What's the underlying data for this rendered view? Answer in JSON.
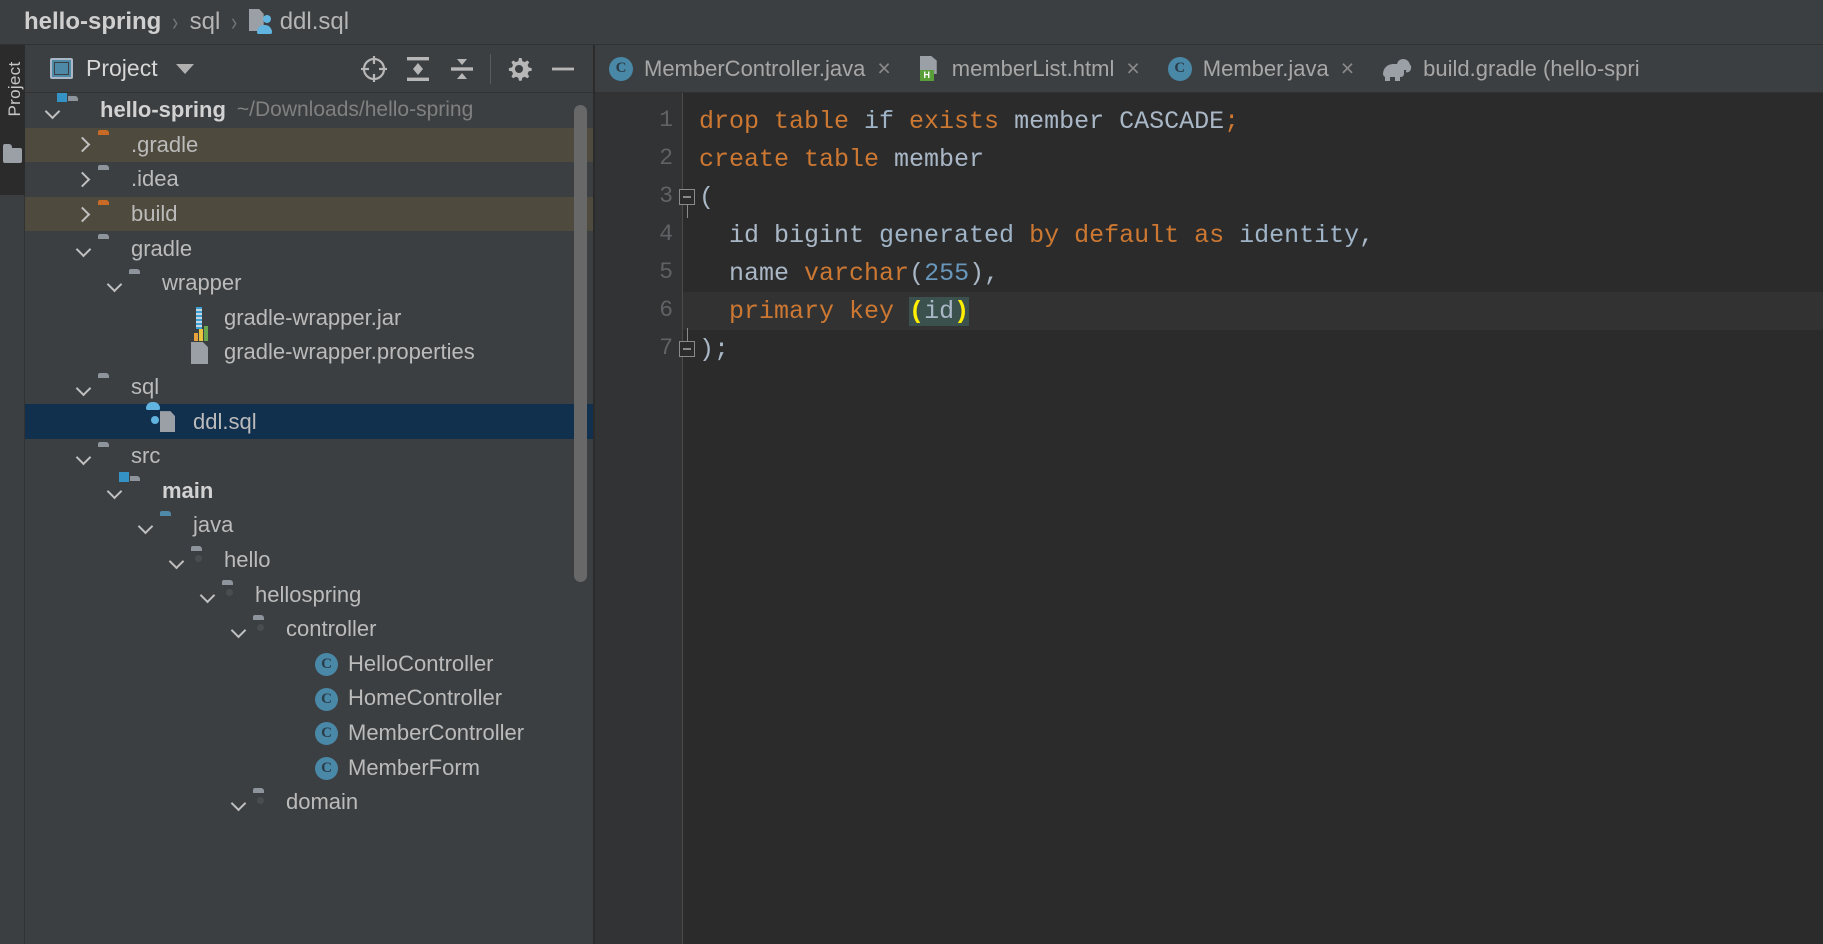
{
  "breadcrumb": {
    "project": "hello-spring",
    "folder": "sql",
    "file": "ddl.sql",
    "sep": "›",
    "file_icon": "sql-file-icon"
  },
  "tool_strip": {
    "label": "Project",
    "icon": "project-folder-icon"
  },
  "project_panel": {
    "title": "Project",
    "caret_icon": "chevron-down-icon",
    "panel_icon": "project-view-icon",
    "toolbar": [
      {
        "name": "select-opened-file-button",
        "icon": "crosshair-target-icon"
      },
      {
        "name": "expand-all-button",
        "icon": "expand-all-icon"
      },
      {
        "name": "collapse-all-button",
        "icon": "collapse-all-icon"
      },
      {
        "name": "settings-button",
        "icon": "gear-icon"
      },
      {
        "name": "hide-button",
        "icon": "minus-icon"
      }
    ],
    "tree": [
      {
        "label": "hello-spring",
        "path": "~/Downloads/hello-spring",
        "indent": 0,
        "arrow": "down",
        "icon": "module-folder-icon",
        "state": "normal",
        "bold": true
      },
      {
        "label": ".gradle",
        "path": "",
        "indent": 1,
        "arrow": "right",
        "icon": "excluded-folder-icon",
        "state": "excluded",
        "bold": false
      },
      {
        "label": ".idea",
        "path": "",
        "indent": 1,
        "arrow": "right",
        "icon": "folder-icon",
        "state": "normal",
        "bold": false
      },
      {
        "label": "build",
        "path": "",
        "indent": 1,
        "arrow": "right",
        "icon": "excluded-folder-icon",
        "state": "excluded",
        "bold": false
      },
      {
        "label": "gradle",
        "path": "",
        "indent": 1,
        "arrow": "down",
        "icon": "folder-icon",
        "state": "normal",
        "bold": false
      },
      {
        "label": "wrapper",
        "path": "",
        "indent": 2,
        "arrow": "down",
        "icon": "folder-icon",
        "state": "normal",
        "bold": false
      },
      {
        "label": "gradle-wrapper.jar",
        "path": "",
        "indent": 4,
        "arrow": "none",
        "icon": "jar-file-icon",
        "state": "normal",
        "bold": false
      },
      {
        "label": "gradle-wrapper.properties",
        "path": "",
        "indent": 4,
        "arrow": "none",
        "icon": "properties-file-icon",
        "state": "normal",
        "bold": false
      },
      {
        "label": "sql",
        "path": "",
        "indent": 1,
        "arrow": "down",
        "icon": "folder-icon",
        "state": "normal",
        "bold": false
      },
      {
        "label": "ddl.sql",
        "path": "",
        "indent": 3,
        "arrow": "none",
        "icon": "sql-file-icon",
        "state": "selected",
        "bold": false
      },
      {
        "label": "src",
        "path": "",
        "indent": 1,
        "arrow": "down",
        "icon": "folder-icon",
        "state": "normal",
        "bold": false
      },
      {
        "label": "main",
        "path": "",
        "indent": 2,
        "arrow": "down",
        "icon": "module-folder-icon",
        "state": "normal",
        "bold": true
      },
      {
        "label": "java",
        "path": "",
        "indent": 3,
        "arrow": "down",
        "icon": "source-folder-icon",
        "state": "normal",
        "bold": false
      },
      {
        "label": "hello",
        "path": "",
        "indent": 4,
        "arrow": "down",
        "icon": "package-icon",
        "state": "normal",
        "bold": false
      },
      {
        "label": "hellospring",
        "path": "",
        "indent": 5,
        "arrow": "down",
        "icon": "package-icon",
        "state": "normal",
        "bold": false
      },
      {
        "label": "controller",
        "path": "",
        "indent": 6,
        "arrow": "down",
        "icon": "package-icon",
        "state": "normal",
        "bold": false
      },
      {
        "label": "HelloController",
        "path": "",
        "indent": 8,
        "arrow": "none",
        "icon": "java-class-icon",
        "state": "normal",
        "bold": false
      },
      {
        "label": "HomeController",
        "path": "",
        "indent": 8,
        "arrow": "none",
        "icon": "java-class-icon",
        "state": "normal",
        "bold": false
      },
      {
        "label": "MemberController",
        "path": "",
        "indent": 8,
        "arrow": "none",
        "icon": "java-class-icon",
        "state": "normal",
        "bold": false
      },
      {
        "label": "MemberForm",
        "path": "",
        "indent": 8,
        "arrow": "none",
        "icon": "java-class-icon",
        "state": "normal",
        "bold": false
      },
      {
        "label": "domain",
        "path": "",
        "indent": 6,
        "arrow": "down",
        "icon": "package-icon",
        "state": "normal",
        "bold": false
      }
    ]
  },
  "editor": {
    "tabs": [
      {
        "label": "MemberController.java",
        "icon": "java-class-icon",
        "closable": true,
        "active": false
      },
      {
        "label": "memberList.html",
        "icon": "html-file-icon",
        "closable": true,
        "active": false
      },
      {
        "label": "Member.java",
        "icon": "java-class-icon",
        "closable": true,
        "active": false
      },
      {
        "label": "build.gradle (hello-spri",
        "icon": "gradle-file-icon",
        "closable": false,
        "active": false
      }
    ],
    "close_glyph": "×",
    "caret_line": 6,
    "lines": [
      {
        "num": 1,
        "fold": "",
        "tokens": [
          {
            "t": "drop table ",
            "c": "kw"
          },
          {
            "t": "if ",
            "c": "kw2"
          },
          {
            "t": "exists ",
            "c": "kw"
          },
          {
            "t": "member ",
            "c": "plain"
          },
          {
            "t": "CASCADE",
            "c": "plain"
          },
          {
            "t": ";",
            "c": "kw"
          }
        ]
      },
      {
        "num": 2,
        "fold": "",
        "tokens": [
          {
            "t": "create table ",
            "c": "kw"
          },
          {
            "t": "member",
            "c": "plain"
          }
        ]
      },
      {
        "num": 3,
        "fold": "start",
        "tokens": [
          {
            "t": "(",
            "c": "plain"
          }
        ]
      },
      {
        "num": 4,
        "fold": "",
        "tokens": [
          {
            "t": "  id bigint ",
            "c": "plain"
          },
          {
            "t": "generated ",
            "c": "kw2"
          },
          {
            "t": "by default as ",
            "c": "kw"
          },
          {
            "t": "identity",
            "c": "kw2"
          },
          {
            "t": ",",
            "c": "plain"
          }
        ]
      },
      {
        "num": 5,
        "fold": "",
        "tokens": [
          {
            "t": "  name ",
            "c": "plain"
          },
          {
            "t": "varchar",
            "c": "kw"
          },
          {
            "t": "(",
            "c": "plain"
          },
          {
            "t": "255",
            "c": "num"
          },
          {
            "t": "),",
            "c": "plain"
          }
        ]
      },
      {
        "num": 6,
        "fold": "",
        "tokens": [
          {
            "t": "  primary key ",
            "c": "kw"
          },
          {
            "t": "(",
            "c": "brace-hl"
          },
          {
            "t": "id",
            "c": "id-hl"
          },
          {
            "t": ")",
            "c": "brace-hl"
          }
        ]
      },
      {
        "num": 7,
        "fold": "end",
        "tokens": [
          {
            "t": ");",
            "c": "plain"
          }
        ]
      }
    ]
  },
  "colors": {
    "panel_bg": "#3c3f41",
    "editor_bg": "#2b2b2b",
    "gutter_bg": "#313335",
    "selection": "#11304d",
    "excluded_row": "#4e4a3d",
    "caret_line": "#323232",
    "keyword": "#cc7832",
    "number": "#6897bb",
    "text": "#a9b7c6",
    "accent_blue": "#4a88a8",
    "excluded_folder": "#c96b26",
    "brace_match": "#ffef00"
  }
}
